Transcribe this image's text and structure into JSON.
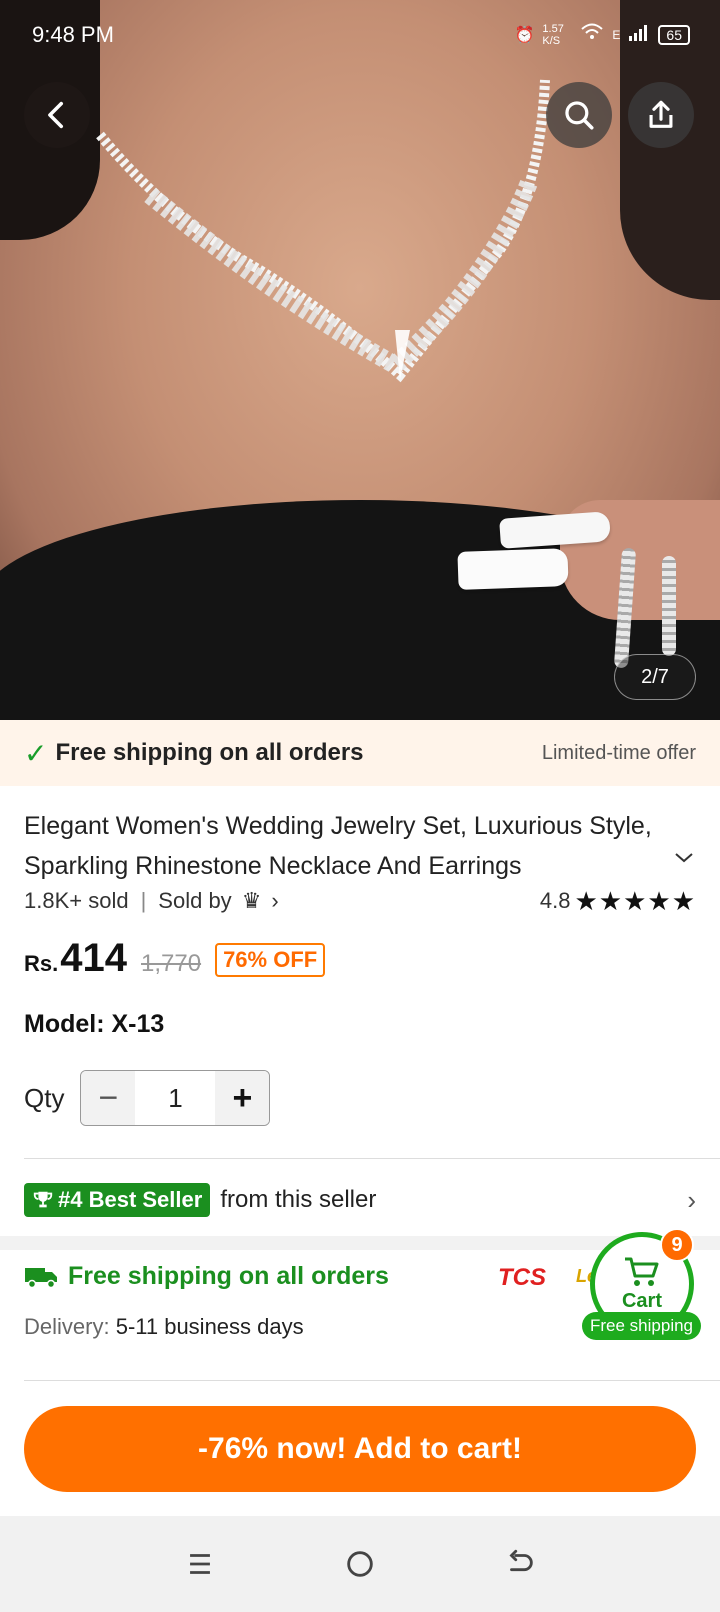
{
  "status_bar": {
    "time": "9:48 PM",
    "net_speed": "1.57 K/S",
    "network": "E",
    "battery": "65"
  },
  "gallery": {
    "page_indicator": "2/7"
  },
  "promo_banner": {
    "text": "Free shipping on all orders",
    "offer": "Limited-time offer"
  },
  "product": {
    "title": "Elegant Women's Wedding Jewelry Set, Luxurious Style, Sparkling Rhinestone Necklace And Earrings",
    "sold": "1.8K+ sold",
    "sold_by": "Sold by",
    "rating": "4.8",
    "rating_value": 4.8,
    "price_currency": "Rs.",
    "price": "414",
    "original_price": "1,770",
    "discount": "76% OFF",
    "model": "Model: X-13"
  },
  "quantity": {
    "label": "Qty",
    "value": "1"
  },
  "best_seller": {
    "badge": "#4 Best Seller",
    "text": "from this seller"
  },
  "shipping": {
    "title": "Free shipping on all orders",
    "delivery_label": "Delivery:",
    "delivery_value": "5-11 business days",
    "courier1": "TCS",
    "courier2": "Leo"
  },
  "cart_float": {
    "label": "Cart",
    "count": "9",
    "free_shipping": "Free shipping"
  },
  "cta": {
    "label": "-76% now! Add to cart!"
  },
  "colors": {
    "accent": "#ff7000",
    "green": "#1b8f1f",
    "promo_bg": "#fff4ea"
  }
}
